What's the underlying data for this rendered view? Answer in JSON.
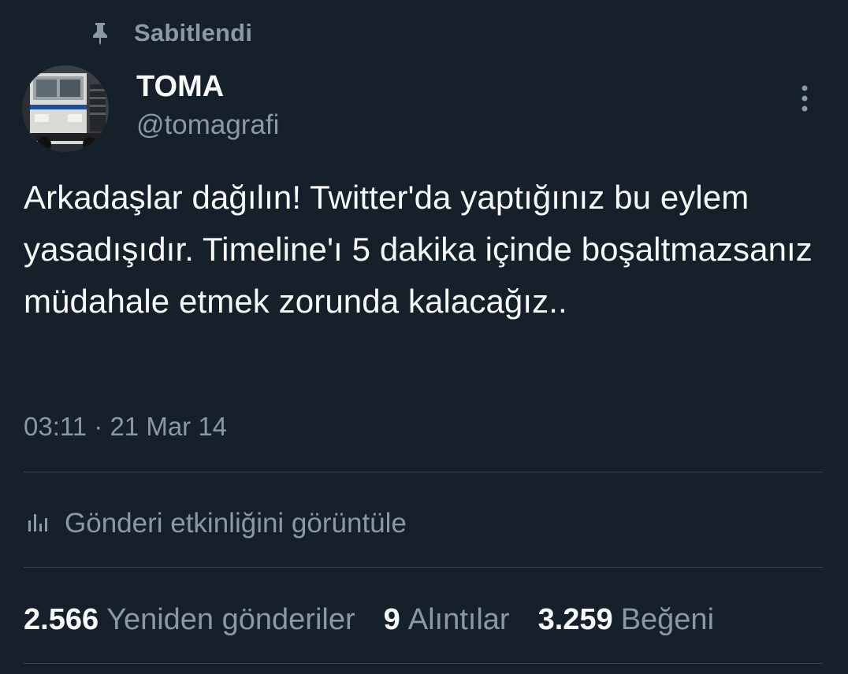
{
  "pinned": {
    "icon": "pin-icon",
    "label": "Sabitlendi"
  },
  "author": {
    "avatar_icon": "avatar-toma-vehicle",
    "display_name": "TOMA",
    "handle": "@tomagrafi"
  },
  "menu": {
    "icon": "more-vertical-icon"
  },
  "tweet": {
    "text": "Arkadaşlar dağılın! Twitter'da yaptığınız bu eylem yasadışıdır. Timeline'ı 5 dakika içinde boşaltmazsanız müdahale etmek zorunda kalacağız..",
    "timestamp": "03:11 · 21 Mar 14"
  },
  "analytics": {
    "icon": "analytics-bars-icon",
    "label": "Gönderi etkinliğini görüntüle"
  },
  "stats": [
    {
      "count": "2.566",
      "label": "Yeniden gönderiler"
    },
    {
      "count": "9",
      "label": "Alıntılar"
    },
    {
      "count": "3.259",
      "label": "Beğeni"
    }
  ],
  "colors": {
    "background": "#15202b",
    "primary_text": "#f7f9f9",
    "secondary_text": "#8b98a5",
    "divider": "#38444d"
  }
}
